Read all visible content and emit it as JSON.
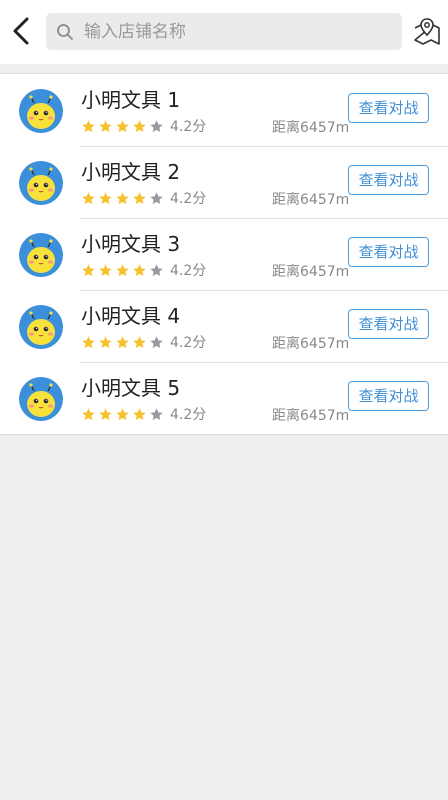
{
  "header": {
    "back_icon": "chevron-left-icon",
    "search": {
      "placeholder": "输入店铺名称",
      "value": ""
    },
    "map_icon": "map-location-icon"
  },
  "colors": {
    "star_filled": "#f6c22c",
    "star_empty": "#9a9a9a",
    "accent": "#3d8fd6",
    "avatar_bg": "#3b8fdb",
    "avatar_face": "#f7e23b"
  },
  "shops": [
    {
      "name": "小明文具 1",
      "stars": 4,
      "rating": "4.2分",
      "distance": "距离6457m",
      "button": "查看对战"
    },
    {
      "name": "小明文具 2",
      "stars": 4,
      "rating": "4.2分",
      "distance": "距离6457m",
      "button": "查看对战"
    },
    {
      "name": "小明文具 3",
      "stars": 4,
      "rating": "4.2分",
      "distance": "距离6457m",
      "button": "查看对战"
    },
    {
      "name": "小明文具 4",
      "stars": 4,
      "rating": "4.2分",
      "distance": "距离6457m",
      "button": "查看对战"
    },
    {
      "name": "小明文具 5",
      "stars": 4,
      "rating": "4.2分",
      "distance": "距离6457m",
      "button": "查看对战"
    }
  ]
}
